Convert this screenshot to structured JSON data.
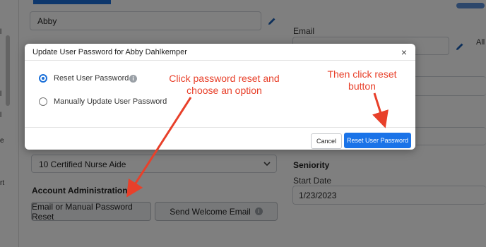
{
  "background_form": {
    "name_value": "Abby",
    "email_label": "Email",
    "right_fragment": "All",
    "job_select_value": "10 Certified Nurse Aide",
    "seniority_title": "Seniority",
    "start_date_label": "Start Date",
    "start_date_value": "1/23/2023",
    "account_admin_title": "Account Administration",
    "email_reset_button": "Email or Manual Password Reset",
    "welcome_email_button": "Send Welcome Email",
    "left_fragments": [
      "l",
      "l",
      "l",
      "e",
      "rt"
    ]
  },
  "modal": {
    "title": "Update User Password for Abby Dahlkemper",
    "close_label": "×",
    "options": [
      {
        "label": "Reset User Password",
        "selected": true
      },
      {
        "label": "Manually Update User Password",
        "selected": false
      }
    ],
    "cancel_label": "Cancel",
    "reset_label": "Reset User Password"
  },
  "annotations": {
    "left_note": "Click password reset and choose an option",
    "right_note": "Then click reset button",
    "color": "#e8402a"
  },
  "colors": {
    "accent": "#1a73e8",
    "overlay": "rgba(0,0,0,0.5)"
  }
}
